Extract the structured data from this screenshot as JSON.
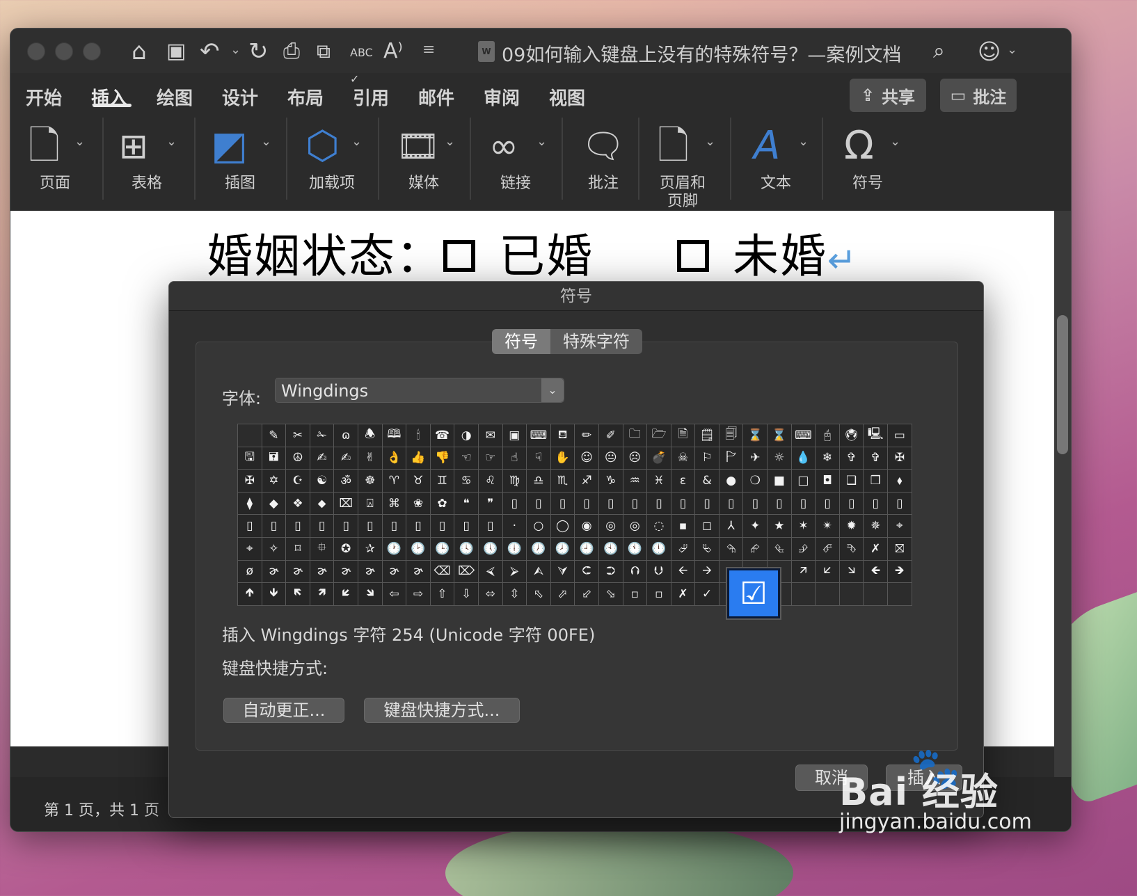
{
  "window": {
    "title": "09如何输入键盘上没有的特殊符号？—案例文档",
    "doc_icon": "W"
  },
  "titlebar_icons": [
    "home-icon",
    "save-icon",
    "undo-icon",
    "redo-icon",
    "print-icon",
    "copy-format-icon",
    "spellcheck-icon",
    "read-aloud-icon",
    "customize-icon"
  ],
  "menu": {
    "tabs": [
      "开始",
      "插入",
      "绘图",
      "设计",
      "布局",
      "引用",
      "邮件",
      "审阅",
      "视图"
    ],
    "active": "插入",
    "share_label": "共享",
    "comment_label": "批注"
  },
  "ribbon": [
    {
      "label": "页面",
      "icon": "page-icon"
    },
    {
      "label": "表格",
      "icon": "table-icon"
    },
    {
      "label": "插图",
      "icon": "illustration-icon"
    },
    {
      "label": "加载项",
      "icon": "addin-icon"
    },
    {
      "label": "媒体",
      "icon": "media-icon"
    },
    {
      "label": "链接",
      "icon": "link-icon"
    },
    {
      "label": "批注",
      "icon": "comment-icon"
    },
    {
      "label": "页眉和\n页脚",
      "icon": "header-footer-icon"
    },
    {
      "label": "文本",
      "icon": "text-icon"
    },
    {
      "label": "符号",
      "icon": "symbol-icon"
    }
  ],
  "document": {
    "line_label": "婚姻状态：",
    "option_married": "已婚",
    "option_unmarried": "未婚",
    "return_mark": "↵"
  },
  "status": {
    "page_info": "第 1 页，共 1 页"
  },
  "dialog": {
    "title": "符号",
    "tabs": [
      "符号",
      "特殊字符"
    ],
    "active_tab": "符号",
    "font_label": "字体:",
    "font_value": "Wingdings",
    "selected_glyph": "☑",
    "insert_info": "插入 Wingdings 字符 254 (Unicode 字符 00FE)",
    "shortcut_label": "键盘快捷方式:",
    "autocorrect_button": "自动更正...",
    "shortcut_button": "键盘快捷方式...",
    "cancel_button": "取消",
    "insert_button": "插入"
  },
  "symbol_grid": [
    "",
    "✎",
    "✂",
    "✁",
    "ɷ",
    "🕭",
    "🕮",
    "🕯",
    "☎",
    "◑",
    "✉",
    "▣",
    "⌨",
    "⛾",
    "✏",
    "✐",
    "🗀",
    "🗁",
    "🗎",
    "🗒",
    "🗐",
    "⌛",
    "⌛",
    "⌨",
    "🖰",
    "🖲",
    "🖳",
    "▭",
    "🖫",
    "🖬",
    "☮",
    "✍",
    "✍",
    "✌",
    "👌",
    "👍",
    "👎",
    "☜",
    "☞",
    "☝",
    "☟",
    "✋",
    "☺",
    "😐",
    "☹",
    "💣",
    "☠",
    "⚐",
    "🏱",
    "✈",
    "☼",
    "💧",
    "❄",
    "✞",
    "✞",
    "✠",
    "✠",
    "✡",
    "☪",
    "☯",
    "ॐ",
    "☸",
    "♈",
    "♉",
    "♊",
    "♋",
    "♌",
    "♍",
    "♎",
    "♏",
    "♐",
    "♑",
    "♒",
    "♓",
    "ɛ",
    "&",
    "●",
    "❍",
    "■",
    "□",
    "◘",
    "❑",
    "❒",
    "⬧",
    "⧫",
    "◆",
    "❖",
    "⬥",
    "⌧",
    "⍓",
    "⌘",
    "❀",
    "✿",
    "❝",
    "❞",
    "▯",
    "▯",
    "▯",
    "▯",
    "▯",
    "▯",
    "▯",
    "▯",
    "▯",
    "▯",
    "▯",
    "▯",
    "▯",
    "▯",
    "▯",
    "▯",
    "▯",
    "▯",
    "▯",
    "▯",
    "▯",
    "▯",
    "▯",
    "▯",
    "▯",
    "▯",
    "▯",
    "▯",
    "·",
    "○",
    "◯",
    "◉",
    "◎",
    "◎",
    "◌",
    "▪",
    "◻",
    "⅄",
    "✦",
    "★",
    "✶",
    "✴",
    "✹",
    "✵",
    "⌖",
    "⌖",
    "✧",
    "⌑",
    "⯐",
    "✪",
    "✰",
    "🕐",
    "🕑",
    "🕒",
    "🕓",
    "🕔",
    "🕕",
    "🕖",
    "🕗",
    "🕘",
    "🕙",
    "🕚",
    "🕛",
    "⮰",
    "⮱",
    "⮲",
    "⮳",
    "⮴",
    "⮵",
    "⮶",
    "⮷",
    "✗",
    "⛝",
    "ø",
    "ɚ",
    "ɚ",
    "ɚ",
    "ɚ",
    "ɚ",
    "ɚ",
    "ɚ",
    "⌫",
    "⌦",
    "⮘",
    "⮚",
    "⮙",
    "⮛",
    "⮈",
    "⮊",
    "⮉",
    "⮋",
    "🡨",
    "🡪",
    "",
    "",
    "",
    "🡭",
    "🡯",
    "🡮",
    "🡸",
    "🡺",
    "🡹",
    "🡻",
    "🡼",
    "🡽",
    "🡿",
    "🡾",
    "⇦",
    "⇨",
    "⇧",
    "⇩",
    "⬄",
    "⇳",
    "⬁",
    "⬀",
    "⬃",
    "⬂",
    "▫",
    "▫",
    "✗",
    "✓",
    "",
    "",
    "",
    "",
    "",
    "",
    "",
    ""
  ],
  "watermark": {
    "brand": "Bai 经验",
    "url": "jingyan.baidu.com"
  }
}
